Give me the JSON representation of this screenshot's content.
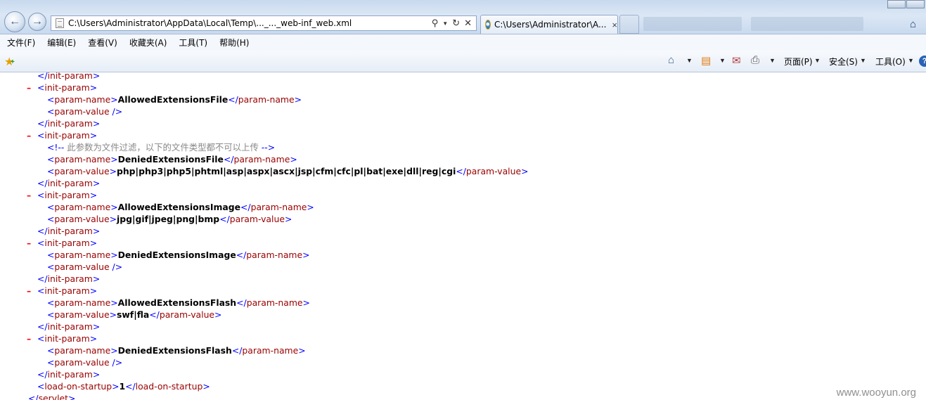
{
  "browser": {
    "address": "C:\\Users\\Administrator\\AppData\\Local\\Temp\\..._..._web-inf_web.xml",
    "tab_title": "C:\\Users\\Administrator\\A...",
    "tab_close": "×"
  },
  "menu": [
    "文件(F)",
    "编辑(E)",
    "查看(V)",
    "收藏夹(A)",
    "工具(T)",
    "帮助(H)"
  ],
  "command_bar": {
    "page": "页面(P)",
    "safety": "安全(S)",
    "tools": "工具(O)"
  },
  "xml_lines": [
    {
      "minus": "",
      "segments": [
        [
          "tag",
          "</"
        ],
        [
          "tn",
          "init-param"
        ],
        [
          "tag",
          ">"
        ]
      ]
    },
    {
      "minus": "–",
      "segments": [
        [
          "tag",
          "<"
        ],
        [
          "tn",
          "init-param"
        ],
        [
          "tag",
          ">"
        ]
      ]
    },
    {
      "minus": "",
      "segments": [
        [
          "tag",
          "<"
        ],
        [
          "tn",
          "param-name"
        ],
        [
          "tag",
          ">"
        ],
        [
          "val",
          "AllowedExtensionsFile"
        ],
        [
          "tag",
          "</"
        ],
        [
          "tn",
          "param-name"
        ],
        [
          "tag",
          ">"
        ]
      ]
    },
    {
      "minus": "",
      "segments": [
        [
          "tag",
          "<"
        ],
        [
          "tn",
          "param-value"
        ],
        [
          "tag",
          " />"
        ]
      ]
    },
    {
      "minus": "",
      "segments": [
        [
          "tag",
          "</"
        ],
        [
          "tn",
          "init-param"
        ],
        [
          "tag",
          ">"
        ]
      ]
    },
    {
      "minus": "–",
      "segments": [
        [
          "tag",
          "<"
        ],
        [
          "tn",
          "init-param"
        ],
        [
          "tag",
          ">"
        ]
      ]
    },
    {
      "minus": "",
      "segments": [
        [
          "tag",
          "<!--"
        ],
        [
          "cmt-txt",
          "  此参数为文件过滤，以下的文件类型都不可以上传  "
        ],
        [
          "tag",
          "-->"
        ]
      ]
    },
    {
      "minus": "",
      "segments": [
        [
          "tag",
          "<"
        ],
        [
          "tn",
          "param-name"
        ],
        [
          "tag",
          ">"
        ],
        [
          "val",
          "DeniedExtensionsFile"
        ],
        [
          "tag",
          "</"
        ],
        [
          "tn",
          "param-name"
        ],
        [
          "tag",
          ">"
        ]
      ]
    },
    {
      "minus": "",
      "segments": [
        [
          "tag",
          "<"
        ],
        [
          "tn",
          "param-value"
        ],
        [
          "tag",
          ">"
        ],
        [
          "val",
          "php|php3|php5|phtml|asp|aspx|ascx|jsp|cfm|cfc|pl|bat|exe|dll|reg|cgi"
        ],
        [
          "tag",
          "</"
        ],
        [
          "tn",
          "param-value"
        ],
        [
          "tag",
          ">"
        ]
      ]
    },
    {
      "minus": "",
      "segments": [
        [
          "tag",
          "</"
        ],
        [
          "tn",
          "init-param"
        ],
        [
          "tag",
          ">"
        ]
      ]
    },
    {
      "minus": "–",
      "segments": [
        [
          "tag",
          "<"
        ],
        [
          "tn",
          "init-param"
        ],
        [
          "tag",
          ">"
        ]
      ]
    },
    {
      "minus": "",
      "segments": [
        [
          "tag",
          "<"
        ],
        [
          "tn",
          "param-name"
        ],
        [
          "tag",
          ">"
        ],
        [
          "val",
          "AllowedExtensionsImage"
        ],
        [
          "tag",
          "</"
        ],
        [
          "tn",
          "param-name"
        ],
        [
          "tag",
          ">"
        ]
      ]
    },
    {
      "minus": "",
      "segments": [
        [
          "tag",
          "<"
        ],
        [
          "tn",
          "param-value"
        ],
        [
          "tag",
          ">"
        ],
        [
          "val",
          "jpg|gif|jpeg|png|bmp"
        ],
        [
          "tag",
          "</"
        ],
        [
          "tn",
          "param-value"
        ],
        [
          "tag",
          ">"
        ]
      ]
    },
    {
      "minus": "",
      "segments": [
        [
          "tag",
          "</"
        ],
        [
          "tn",
          "init-param"
        ],
        [
          "tag",
          ">"
        ]
      ]
    },
    {
      "minus": "–",
      "segments": [
        [
          "tag",
          "<"
        ],
        [
          "tn",
          "init-param"
        ],
        [
          "tag",
          ">"
        ]
      ]
    },
    {
      "minus": "",
      "segments": [
        [
          "tag",
          "<"
        ],
        [
          "tn",
          "param-name"
        ],
        [
          "tag",
          ">"
        ],
        [
          "val",
          "DeniedExtensionsImage"
        ],
        [
          "tag",
          "</"
        ],
        [
          "tn",
          "param-name"
        ],
        [
          "tag",
          ">"
        ]
      ]
    },
    {
      "minus": "",
      "segments": [
        [
          "tag",
          "<"
        ],
        [
          "tn",
          "param-value"
        ],
        [
          "tag",
          " />"
        ]
      ]
    },
    {
      "minus": "",
      "segments": [
        [
          "tag",
          "</"
        ],
        [
          "tn",
          "init-param"
        ],
        [
          "tag",
          ">"
        ]
      ]
    },
    {
      "minus": "–",
      "segments": [
        [
          "tag",
          "<"
        ],
        [
          "tn",
          "init-param"
        ],
        [
          "tag",
          ">"
        ]
      ]
    },
    {
      "minus": "",
      "segments": [
        [
          "tag",
          "<"
        ],
        [
          "tn",
          "param-name"
        ],
        [
          "tag",
          ">"
        ],
        [
          "val",
          "AllowedExtensionsFlash"
        ],
        [
          "tag",
          "</"
        ],
        [
          "tn",
          "param-name"
        ],
        [
          "tag",
          ">"
        ]
      ]
    },
    {
      "minus": "",
      "segments": [
        [
          "tag",
          "<"
        ],
        [
          "tn",
          "param-value"
        ],
        [
          "tag",
          ">"
        ],
        [
          "val",
          "swf|fla"
        ],
        [
          "tag",
          "</"
        ],
        [
          "tn",
          "param-value"
        ],
        [
          "tag",
          ">"
        ]
      ]
    },
    {
      "minus": "",
      "segments": [
        [
          "tag",
          "</"
        ],
        [
          "tn",
          "init-param"
        ],
        [
          "tag",
          ">"
        ]
      ]
    },
    {
      "minus": "–",
      "segments": [
        [
          "tag",
          "<"
        ],
        [
          "tn",
          "init-param"
        ],
        [
          "tag",
          ">"
        ]
      ]
    },
    {
      "minus": "",
      "segments": [
        [
          "tag",
          "<"
        ],
        [
          "tn",
          "param-name"
        ],
        [
          "tag",
          ">"
        ],
        [
          "val",
          "DeniedExtensionsFlash"
        ],
        [
          "tag",
          "</"
        ],
        [
          "tn",
          "param-name"
        ],
        [
          "tag",
          ">"
        ]
      ]
    },
    {
      "minus": "",
      "segments": [
        [
          "tag",
          "<"
        ],
        [
          "tn",
          "param-value"
        ],
        [
          "tag",
          " />"
        ]
      ]
    },
    {
      "minus": "",
      "segments": [
        [
          "tag",
          "</"
        ],
        [
          "tn",
          "init-param"
        ],
        [
          "tag",
          ">"
        ]
      ]
    },
    {
      "minus": "",
      "segments": [
        [
          "tag",
          "<"
        ],
        [
          "tn",
          "load-on-startup"
        ],
        [
          "tag",
          ">"
        ],
        [
          "val",
          "1"
        ],
        [
          "tag",
          "</"
        ],
        [
          "tn",
          "load-on-startup"
        ],
        [
          "tag",
          ">"
        ]
      ]
    },
    {
      "minus": "",
      "segments": [
        [
          "tag",
          "</"
        ],
        [
          "tn",
          "servlet"
        ],
        [
          "tag",
          ">"
        ]
      ]
    }
  ],
  "watermark": "www.wooyun.org"
}
